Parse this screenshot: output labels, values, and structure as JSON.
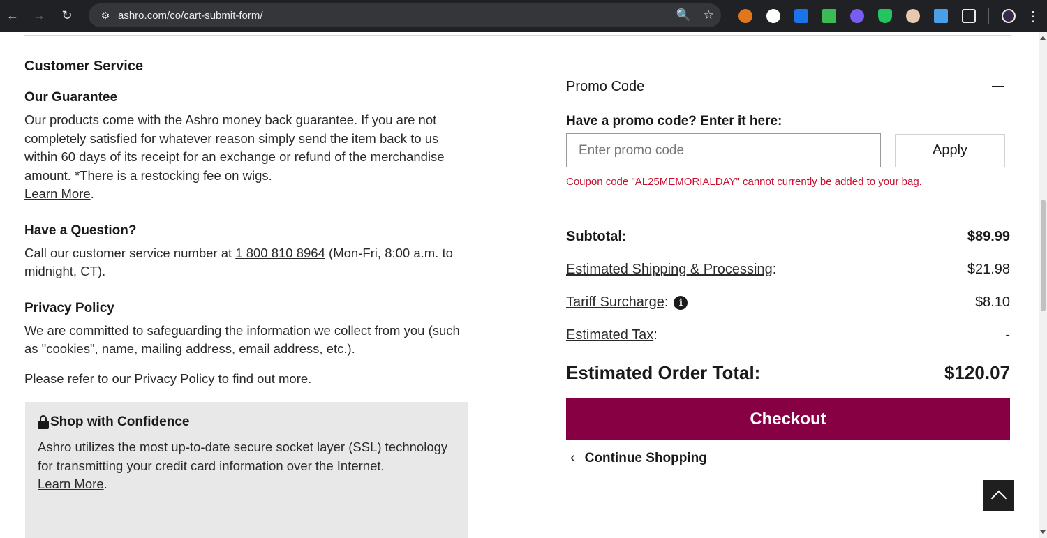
{
  "browser": {
    "url": "ashro.com/co/cart-submit-form/",
    "back_icon": "arrow-left-icon",
    "forward_icon": "arrow-right-icon",
    "reload_icon": "reload-icon"
  },
  "left": {
    "section_title": "Customer Service",
    "guarantee": {
      "heading": "Our Guarantee",
      "text": "Our products come with the Ashro money back guarantee. If you are not completely satisfied for whatever reason simply send the item back to us within 60 days of its receipt for an exchange or refund of the merchandise amount. *There is a restocking fee on wigs.",
      "link": "Learn More",
      "link_suffix": "."
    },
    "question": {
      "heading": "Have a Question?",
      "text_before": "Call our customer service number at ",
      "phone": "1 800 810 8964",
      "text_after": " (Mon-Fri, 8:00 a.m. to midnight, CT)."
    },
    "privacy": {
      "heading": "Privacy Policy",
      "text": "We are committed to safeguarding the information we collect from you (such as \"cookies\", name, mailing address, email address, etc.).",
      "refer_before": "Please refer to our ",
      "refer_link": "Privacy Policy",
      "refer_after": " to find out more."
    },
    "confidence": {
      "title": "Shop with Confidence",
      "text": "Ashro utilizes the most up-to-date secure socket layer (SSL) technology for transmitting your credit card information over the Internet.",
      "link": "Learn More",
      "link_suffix": "."
    }
  },
  "right": {
    "promo": {
      "label": "Promo Code",
      "prompt": "Have a promo code? Enter it here:",
      "placeholder": "Enter promo code",
      "apply_label": "Apply",
      "error": "Coupon code \"AL25MEMORIALDAY\" cannot currently be added to your bag."
    },
    "summary": {
      "subtotal_label": "Subtotal:",
      "subtotal_value": "$89.99",
      "shipping_label": "Estimated Shipping & Processing",
      "shipping_colon": ":",
      "shipping_value": "$21.98",
      "tariff_label": "Tariff Surcharge",
      "tariff_colon": ":",
      "tariff_value": "$8.10",
      "tax_label": "Estimated Tax",
      "tax_colon": ":",
      "tax_value": "-",
      "total_label": "Estimated Order Total:",
      "total_value": "$120.07"
    },
    "checkout_label": "Checkout",
    "continue_label": "Continue Shopping"
  },
  "colors": {
    "checkout": "#860043",
    "error": "#c8102e",
    "confidence_bg": "#e8e8e8"
  }
}
